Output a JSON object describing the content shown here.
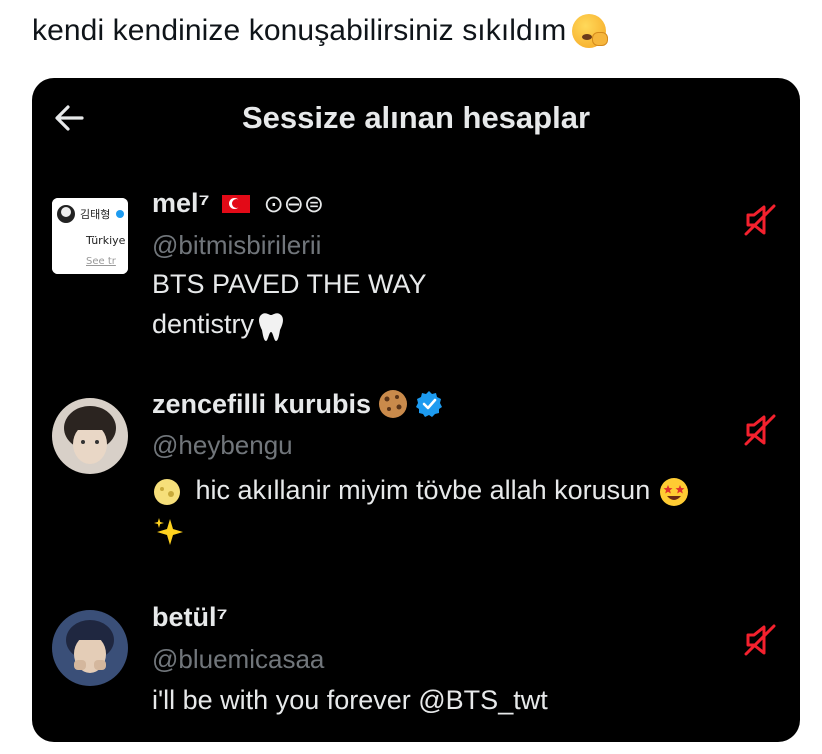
{
  "caption": {
    "text": "kendi kendinize konuşabilirsiniz sıkıldım",
    "emoji": "yawning-face-icon"
  },
  "header": {
    "title": "Sessize alınan hesaplar",
    "back_icon": "arrow-left-icon"
  },
  "accounts": [
    {
      "name": "mel⁷",
      "flag": "turkey-flag-icon",
      "extra_glyphs": "⊙⊖⊜",
      "handle": "@bitmisbirilerii",
      "bio_lines": [
        "BTS PAVED THE WAY",
        "dentistry"
      ],
      "bio_emoji": "tooth-icon",
      "avatar_text": {
        "line1": "김태형",
        "line2": "Türkiye",
        "line3": "See tr"
      }
    },
    {
      "name": "zencefilli kurubis",
      "name_emoji": "cookie-icon",
      "verified": true,
      "handle": "@heybengu",
      "bio_lines": [
        "hic akıllanir miyim tövbe allah korusun"
      ],
      "bio_emojis": [
        "moon-face-icon",
        "star-struck-icon",
        "sparkles-icon"
      ]
    },
    {
      "name": "betül⁷",
      "handle": "@bluemicasaa",
      "bio_lines": [
        "i'll be with you forever @BTS_twt"
      ]
    }
  ],
  "colors": {
    "panel_bg": "#000000",
    "primary_text": "#e7e9ea",
    "secondary_text": "#71767b",
    "mute_red": "#f4212e",
    "verified_blue": "#1d9bf0"
  }
}
